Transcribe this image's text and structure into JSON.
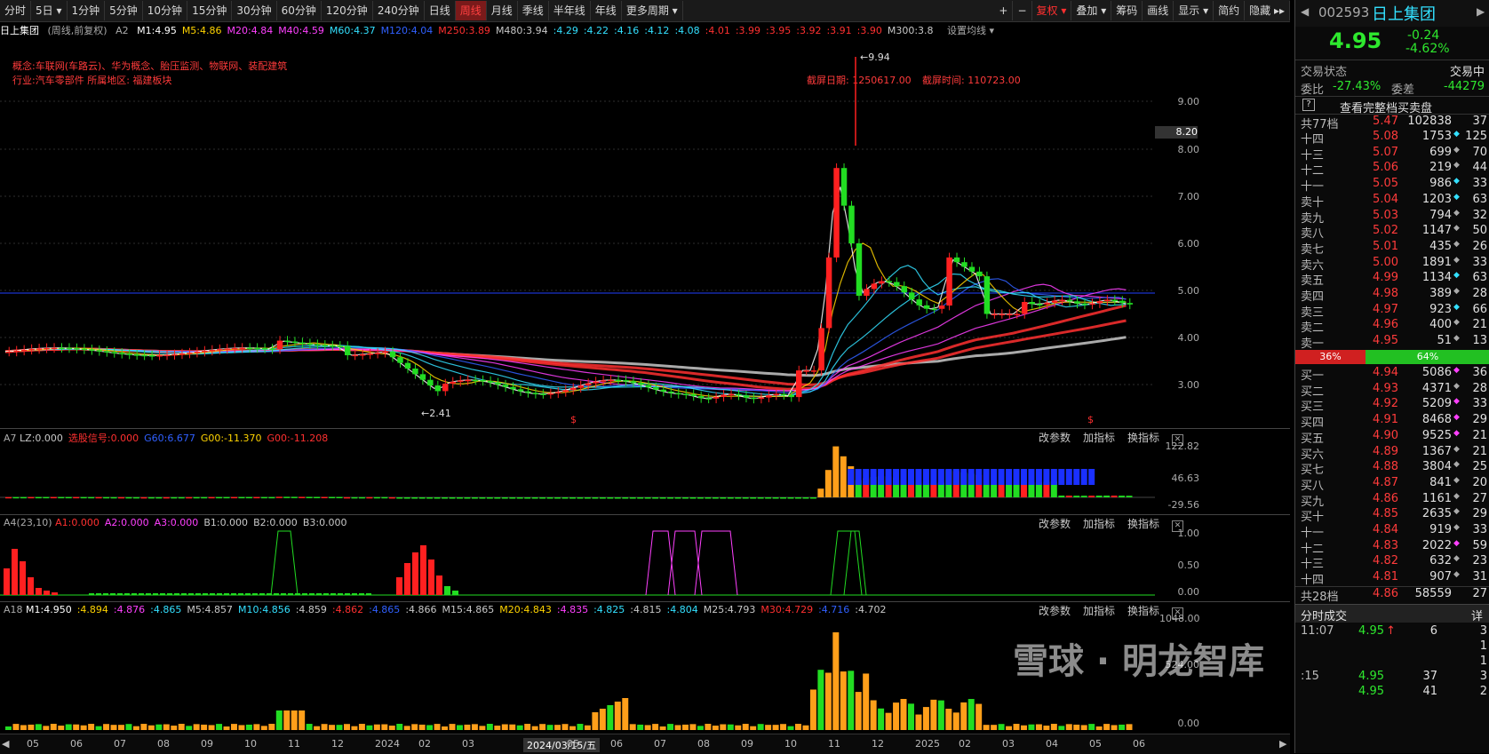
{
  "toolbar": {
    "items": [
      "分时",
      "5日 ▾",
      "1分钟",
      "5分钟",
      "10分钟",
      "15分钟",
      "30分钟",
      "60分钟",
      "120分钟",
      "240分钟",
      "日线",
      "周线",
      "月线",
      "季线",
      "半年线",
      "年线",
      "更多周期 ▾"
    ],
    "active": "周线",
    "right_items": [
      "+",
      "−",
      "复权 ▾",
      "叠加 ▾",
      "筹码",
      "画线",
      "显示 ▾",
      "简约",
      "隐藏 ▸▸"
    ]
  },
  "title": {
    "name": "日上集团",
    "mode": "(周线,前复权)",
    "a2": "A2",
    "mas": [
      {
        "t": "M1:4.95",
        "c": "#ffffff"
      },
      {
        "t": "M5:4.86",
        "c": "#ffd400"
      },
      {
        "t": "M20:4.84",
        "c": "#ff40ff"
      },
      {
        "t": "M40:4.59",
        "c": "#ff40ff"
      },
      {
        "t": "M60:4.37",
        "c": "#33e0ff"
      },
      {
        "t": "M120:4.04",
        "c": "#3060ff"
      },
      {
        "t": "M250:3.89",
        "c": "#ff3030"
      },
      {
        "t": "M480:3.94",
        "c": "#c8c8c8"
      },
      {
        "t": ":4.29",
        "c": "#33e0ff"
      },
      {
        "t": ":4.22",
        "c": "#33e0ff"
      },
      {
        "t": ":4.16",
        "c": "#33e0ff"
      },
      {
        "t": ":4.12",
        "c": "#33e0ff"
      },
      {
        "t": ":4.08",
        "c": "#33e0ff"
      },
      {
        "t": ":4.01",
        "c": "#ff3030"
      },
      {
        "t": ":3.99",
        "c": "#ff3030"
      },
      {
        "t": ":3.95",
        "c": "#ff3030"
      },
      {
        "t": ":3.92",
        "c": "#ff3030"
      },
      {
        "t": ":3.91",
        "c": "#ff3030"
      },
      {
        "t": ":3.90",
        "c": "#ff3030"
      },
      {
        "t": "M300:3.8",
        "c": "#c8c8c8"
      }
    ],
    "settings": "设置均线 ▾"
  },
  "info": {
    "concept": "概念:车联网(车路云)、华为概念、胎压监测、物联网、装配建筑",
    "industry": "行业:汽车零部件  所属地区: 福建板块",
    "screenshot_date": "截屏日期: 1250617.00",
    "screenshot_time": "截屏时间: 110723.00",
    "high_label": "9.94",
    "low_label": "2.41",
    "price_tag": "8.20"
  },
  "price_axis": [
    "9.00",
    "8.00",
    "7.00",
    "6.00",
    "5.00",
    "4.00",
    "3.00"
  ],
  "ind1": {
    "title": "A7",
    "items": [
      {
        "t": "LZ:0.000",
        "c": "#c8c8c8"
      },
      {
        "t": "选股信号:0.000",
        "c": "#ff3030"
      },
      {
        "t": "G60:6.677",
        "c": "#3060ff"
      },
      {
        "t": "G00:-11.370",
        "c": "#ffd400"
      },
      {
        "t": "G00:-11.208",
        "c": "#ff3030"
      }
    ],
    "axis": [
      "122.82",
      "46.63",
      "-29.56"
    ]
  },
  "ind2": {
    "title": "A4(23,10)",
    "items": [
      {
        "t": "A1:0.000",
        "c": "#ff3030"
      },
      {
        "t": "A2:0.000",
        "c": "#ff40ff"
      },
      {
        "t": "A3:0.000",
        "c": "#ff40ff"
      },
      {
        "t": "B1:0.000",
        "c": "#c8c8c8"
      },
      {
        "t": "B2:0.000",
        "c": "#c8c8c8"
      },
      {
        "t": "B3:0.000",
        "c": "#c8c8c8"
      }
    ],
    "axis": [
      "1.00",
      "0.50",
      "0.00"
    ]
  },
  "ind3": {
    "title": "A18",
    "items": [
      {
        "t": "M1:4.950",
        "c": "#ffffff"
      },
      {
        "t": ":4.894",
        "c": "#ffd400"
      },
      {
        "t": ":4.876",
        "c": "#ff40ff"
      },
      {
        "t": ":4.865",
        "c": "#33e0ff"
      },
      {
        "t": "M5:4.857",
        "c": "#c8c8c8"
      },
      {
        "t": "M10:4.856",
        "c": "#33e0ff"
      },
      {
        "t": ":4.859",
        "c": "#c8c8c8"
      },
      {
        "t": ":4.862",
        "c": "#ff3030"
      },
      {
        "t": ":4.865",
        "c": "#3060ff"
      },
      {
        "t": ":4.866",
        "c": "#c8c8c8"
      },
      {
        "t": "M15:4.865",
        "c": "#c8c8c8"
      },
      {
        "t": "M20:4.843",
        "c": "#ffd400"
      },
      {
        "t": ":4.835",
        "c": "#ff40ff"
      },
      {
        "t": ":4.825",
        "c": "#33e0ff"
      },
      {
        "t": ":4.815",
        "c": "#c8c8c8"
      },
      {
        "t": ":4.804",
        "c": "#33e0ff"
      },
      {
        "t": "M25:4.793",
        "c": "#c8c8c8"
      },
      {
        "t": "M30:4.729",
        "c": "#ff3030"
      },
      {
        "t": ":4.716",
        "c": "#3060ff"
      },
      {
        "t": ":4.702",
        "c": "#c8c8c8"
      }
    ],
    "axis": [
      "1048.00",
      "524.00",
      "0.00"
    ]
  },
  "ind_buttons": [
    "改参数",
    "加指标",
    "换指标"
  ],
  "xaxis": [
    "05",
    "06",
    "07",
    "08",
    "09",
    "10",
    "11",
    "12",
    "2024",
    "02",
    "03",
    "2024/03/15/五",
    "05",
    "06",
    "07",
    "08",
    "09",
    "10",
    "11",
    "12",
    "2025",
    "02",
    "03",
    "04",
    "05",
    "06"
  ],
  "quote": {
    "code": "002593",
    "name": "日上集团",
    "price": "4.95",
    "change": "-0.24",
    "change_pct": "-4.62%",
    "trade_status_label": "交易状态",
    "trade_status": "交易中",
    "weibi_label": "委比",
    "weibi": "-27.43%",
    "weicha_label": "委差",
    "weicha": "-44279",
    "view_all": "查看完整档买卖盘",
    "sell_total": {
      "label": "共77档",
      "price": "5.47",
      "vol": "102838",
      "cnt": "37"
    },
    "sells": [
      {
        "l": "十四",
        "p": "5.08",
        "v": "1753",
        "m": "◆",
        "mc": "#33e0ff",
        "n": "125"
      },
      {
        "l": "十三",
        "p": "5.07",
        "v": "699",
        "m": "◆",
        "mc": "#aaa",
        "n": "70"
      },
      {
        "l": "十二",
        "p": "5.06",
        "v": "219",
        "m": "◆",
        "mc": "#aaa",
        "n": "44"
      },
      {
        "l": "十一",
        "p": "5.05",
        "v": "986",
        "m": "◆",
        "mc": "#33e0ff",
        "n": "33"
      },
      {
        "l": "卖十",
        "p": "5.04",
        "v": "1203",
        "m": "◆",
        "mc": "#33e0ff",
        "n": "63"
      },
      {
        "l": "卖九",
        "p": "5.03",
        "v": "794",
        "m": "◆",
        "mc": "#aaa",
        "n": "32"
      },
      {
        "l": "卖八",
        "p": "5.02",
        "v": "1147",
        "m": "◆",
        "mc": "#aaa",
        "n": "50"
      },
      {
        "l": "卖七",
        "p": "5.01",
        "v": "435",
        "m": "◆",
        "mc": "#aaa",
        "n": "26"
      },
      {
        "l": "卖六",
        "p": "5.00",
        "v": "1891",
        "m": "◆",
        "mc": "#aaa",
        "n": "33"
      },
      {
        "l": "卖五",
        "p": "4.99",
        "v": "1134",
        "m": "◆",
        "mc": "#33e0ff",
        "n": "63"
      },
      {
        "l": "卖四",
        "p": "4.98",
        "v": "389",
        "m": "◆",
        "mc": "#aaa",
        "n": "28"
      },
      {
        "l": "卖三",
        "p": "4.97",
        "v": "923",
        "m": "◆",
        "mc": "#33e0ff",
        "n": "66"
      },
      {
        "l": "卖二",
        "p": "4.96",
        "v": "400",
        "m": "◆",
        "mc": "#aaa",
        "n": "21"
      },
      {
        "l": "卖一",
        "p": "4.95",
        "v": "51",
        "m": "◆",
        "mc": "#aaa",
        "n": "13"
      }
    ],
    "ratio_left": "36%",
    "ratio_right": "64%",
    "buys": [
      {
        "l": "买一",
        "p": "4.94",
        "v": "5086",
        "m": "◆",
        "mc": "#ff40ff",
        "n": "36"
      },
      {
        "l": "买二",
        "p": "4.93",
        "v": "4371",
        "m": "◆",
        "mc": "#aaa",
        "n": "28"
      },
      {
        "l": "买三",
        "p": "4.92",
        "v": "5209",
        "m": "◆",
        "mc": "#ff40ff",
        "n": "33"
      },
      {
        "l": "买四",
        "p": "4.91",
        "v": "8468",
        "m": "◆",
        "mc": "#ff40ff",
        "n": "29"
      },
      {
        "l": "买五",
        "p": "4.90",
        "v": "9525",
        "m": "◆",
        "mc": "#ff40ff",
        "n": "21"
      },
      {
        "l": "买六",
        "p": "4.89",
        "v": "1367",
        "m": "◆",
        "mc": "#aaa",
        "n": "21"
      },
      {
        "l": "买七",
        "p": "4.88",
        "v": "3804",
        "m": "◆",
        "mc": "#aaa",
        "n": "25"
      },
      {
        "l": "买八",
        "p": "4.87",
        "v": "841",
        "m": "◆",
        "mc": "#aaa",
        "n": "20"
      },
      {
        "l": "买九",
        "p": "4.86",
        "v": "1161",
        "m": "◆",
        "mc": "#aaa",
        "n": "27"
      },
      {
        "l": "买十",
        "p": "4.85",
        "v": "2635",
        "m": "◆",
        "mc": "#aaa",
        "n": "29"
      },
      {
        "l": "十一",
        "p": "4.84",
        "v": "919",
        "m": "◆",
        "mc": "#aaa",
        "n": "33"
      },
      {
        "l": "十二",
        "p": "4.83",
        "v": "2022",
        "m": "◆",
        "mc": "#ff40ff",
        "n": "59"
      },
      {
        "l": "十三",
        "p": "4.82",
        "v": "632",
        "m": "◆",
        "mc": "#aaa",
        "n": "23"
      },
      {
        "l": "十四",
        "p": "4.81",
        "v": "907",
        "m": "◆",
        "mc": "#aaa",
        "n": "31"
      }
    ],
    "buy_total": {
      "label": "共28档",
      "price": "4.86",
      "vol": "58559",
      "cnt": "27"
    },
    "ticks_title": "分时成交",
    "ticks_detail": "详",
    "ticks": [
      {
        "t": "11:07",
        "p": "4.95",
        "a": "↑",
        "n": "6",
        "c": "3"
      },
      {
        "t": "",
        "p": "",
        "a": "",
        "n": "",
        "c": "1"
      },
      {
        "t": "",
        "p": "",
        "a": "",
        "n": "",
        "c": "1"
      },
      {
        "t": ":15",
        "p": "4.95",
        "a": "",
        "n": "37",
        "c": "3"
      },
      {
        "t": "",
        "p": "4.95",
        "a": "",
        "n": "41",
        "c": "2"
      }
    ]
  },
  "watermark": "雪球 · 明龙智库"
}
